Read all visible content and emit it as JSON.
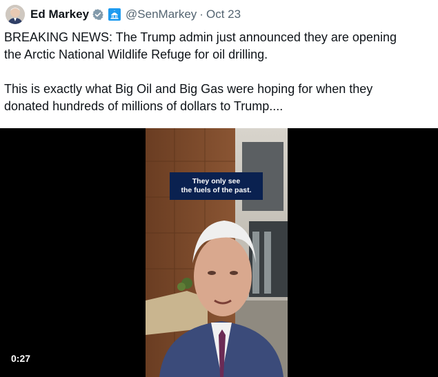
{
  "tweet": {
    "author_name": "Ed Markey",
    "handle": "@SenMarkey",
    "separator": "·",
    "date": "Oct 23",
    "text_lines": [
      "BREAKING NEWS: The Trump admin just announced they are opening",
      "the Arctic National Wildlife Refuge for oil drilling.",
      "This is exactly what Big Oil and Big Gas were hoping for when they",
      "donated hundreds of millions of dollars to Trump...."
    ]
  },
  "video": {
    "caption_line1": "They only see",
    "caption_line2": "the fuels of the past.",
    "timestamp": "0:27"
  },
  "icons": {
    "verified": "verified-badge-icon",
    "government": "capitol-building-icon"
  },
  "colors": {
    "text": "#0f1419",
    "muted": "#536471",
    "verified": "#829aab",
    "caption_bg": "#0a2150"
  }
}
